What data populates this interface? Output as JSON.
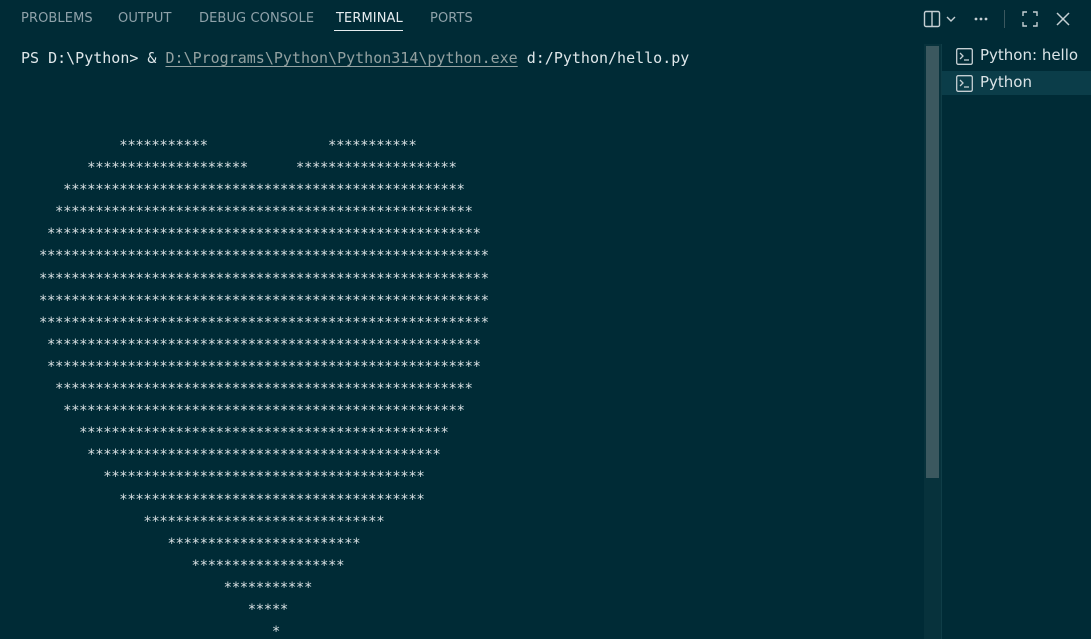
{
  "tabs": [
    {
      "label": "PROBLEMS",
      "active": false
    },
    {
      "label": "OUTPUT",
      "active": false
    },
    {
      "label": "DEBUG CONSOLE",
      "active": false
    },
    {
      "label": "TERMINAL",
      "active": true
    },
    {
      "label": "PORTS",
      "active": false
    }
  ],
  "toolbar": {
    "icons": [
      "split-terminal-icon",
      "chevron-down-icon",
      "more-actions-icon",
      "maximize-panel-icon",
      "close-panel-icon"
    ]
  },
  "terminal": {
    "prompt": "PS D:\\Python> & ",
    "exe_path": "D:\\Programs\\Python\\Python314\\python.exe",
    "script_arg": " d:/Python/hello.py",
    "output_lines": [
      "          ***********               ***********",
      "      ********************      ********************",
      "   **************************************************",
      "  ****************************************************",
      " ******************************************************",
      "********************************************************",
      "********************************************************",
      "********************************************************",
      "********************************************************",
      " ******************************************************",
      " ******************************************************",
      "  ****************************************************",
      "   **************************************************",
      "     **********************************************",
      "      ********************************************",
      "        ****************************************",
      "          **************************************",
      "             ******************************",
      "                ************************",
      "                   *******************",
      "                       ***********",
      "                          *****",
      "                             *"
    ]
  },
  "terminal_list": {
    "items": [
      {
        "label": "Python: hello",
        "selected": false
      },
      {
        "label": "Python",
        "selected": true
      }
    ]
  },
  "colors": {
    "background": "#002b36",
    "accent": "#e6edf0",
    "scroll_thumb": "#3b585f"
  }
}
